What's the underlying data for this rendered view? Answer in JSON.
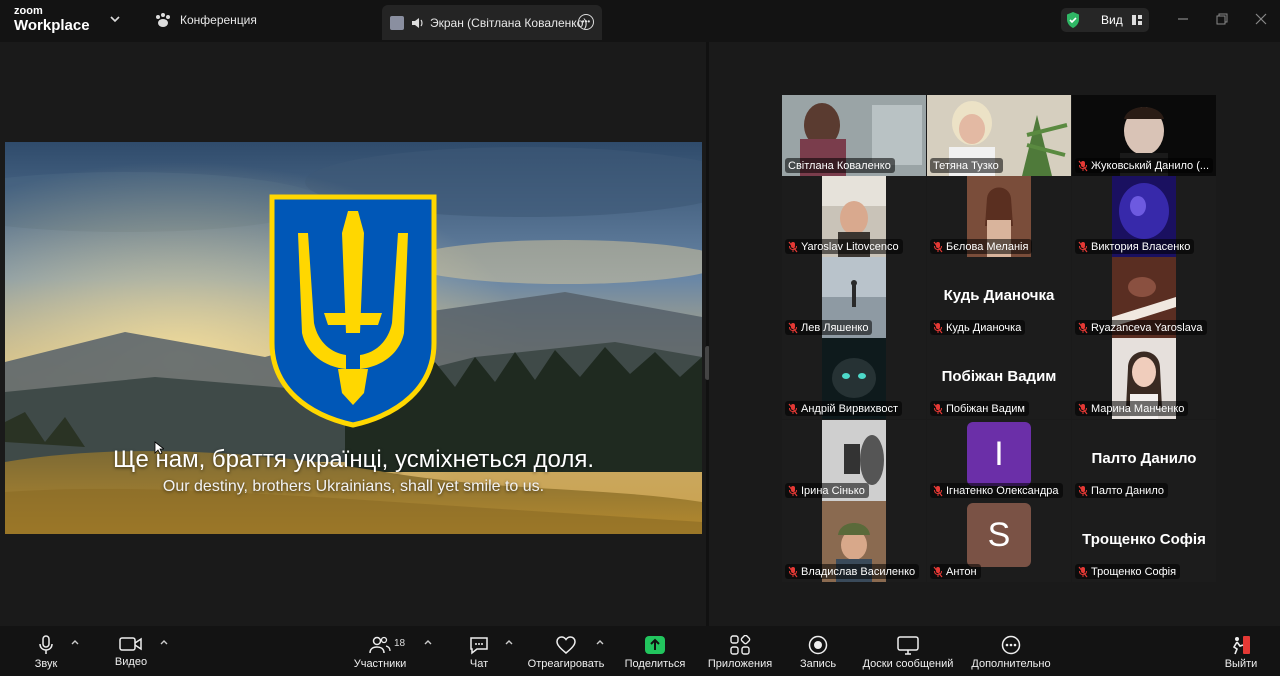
{
  "topbar": {
    "logo_line1": "zoom",
    "logo_line2": "Workplace",
    "conference_label": "Конференция",
    "screen_tab_label": "Экран (Світлана Коваленко)",
    "view_label": "Вид"
  },
  "shared_screen": {
    "lyric_ua": "Ще нам, браття українці, усміхнеться доля.",
    "lyric_en": "Our destiny, brothers Ukrainians, shall yet smile to us."
  },
  "participants": [
    {
      "name": "Світлана Коваленко",
      "muted": false,
      "active": true,
      "video": "woman-dark"
    },
    {
      "name": "Тетяна Тузко",
      "muted": false,
      "video": "woman-blonde"
    },
    {
      "name": "Жуковський Данило (...",
      "muted": true,
      "video": "man-dark"
    },
    {
      "name": "Yaroslav Litovcenco",
      "muted": true,
      "video": "man-room"
    },
    {
      "name": "Бєлова Меланія",
      "muted": true,
      "video": "girl-room"
    },
    {
      "name": "Виктория Власенко",
      "muted": true,
      "video": "blue-light"
    },
    {
      "name": "Лев Ляшенко",
      "muted": true,
      "video": "sea"
    },
    {
      "name": "Кудь Дианочка",
      "muted": true,
      "big_name": "Кудь Дианочка"
    },
    {
      "name": "Ryazanceva Yaroslava",
      "muted": true,
      "video": "piano"
    },
    {
      "name": "Андрій Вирвихвост",
      "muted": true,
      "video": "cat"
    },
    {
      "name": "Побіжан Вадим",
      "muted": true,
      "big_name": "Побіжан Вадим"
    },
    {
      "name": "Марина Манченко",
      "muted": true,
      "video": "girl-portrait"
    },
    {
      "name": "Ірина Сінько",
      "muted": true,
      "video": "bw-photo"
    },
    {
      "name": "Ігнатенко Олександра",
      "muted": true,
      "avatar_letter": "I",
      "avatar_color": "#6b2fa8"
    },
    {
      "name": "Палто Данило",
      "muted": true,
      "big_name": "Палто Данило"
    },
    {
      "name": "Владислав Василенко",
      "muted": true,
      "video": "man-hat"
    },
    {
      "name": "Антон",
      "muted": true,
      "avatar_letter": "S",
      "avatar_color": "#7a5245"
    },
    {
      "name": "Трощенко Софія",
      "muted": true,
      "big_name": "Трощенко Софія"
    }
  ],
  "toolbar": {
    "audio": "Звук",
    "video": "Видео",
    "participants": "Участники",
    "participants_count": "18",
    "chat": "Чат",
    "react": "Отреагировать",
    "share": "Поделиться",
    "apps": "Приложения",
    "record": "Запись",
    "whiteboards": "Доски сообщений",
    "more": "Дополнительно",
    "leave": "Выйти"
  },
  "colors": {
    "active_border": "#3bd66e",
    "share_green": "#22c55e",
    "leave_red": "#e53935",
    "ua_blue": "#0057b7",
    "ua_yellow": "#ffd700"
  }
}
